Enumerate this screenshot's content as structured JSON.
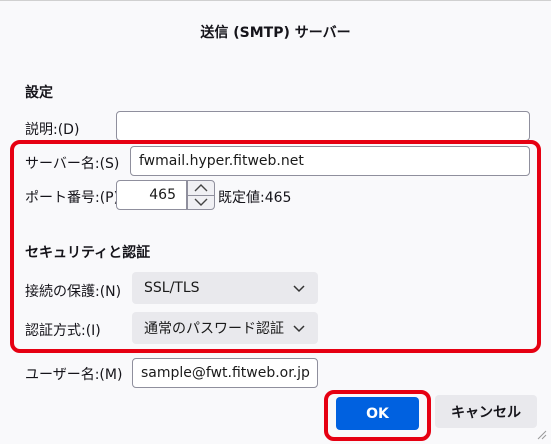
{
  "dialog": {
    "title": "送信 (SMTP) サーバー"
  },
  "settings": {
    "heading": "設定",
    "description_label": "説明:(D)",
    "description_value": "",
    "server_label": "サーバー名:(S)",
    "server_value": "fwmail.hyper.fitweb.net",
    "port_label": "ポート番号:(P)",
    "port_value": "465",
    "port_default": "既定値:465"
  },
  "security": {
    "heading": "セキュリティと認証",
    "connection_label": "接続の保護:(N)",
    "connection_value": "SSL/TLS",
    "auth_label": "認証方式:(I)",
    "auth_value": "通常のパスワード認証",
    "username_label": "ユーザー名:(M)",
    "username_value": "sample@fwt.fitweb.or.jp"
  },
  "buttons": {
    "ok": "OK",
    "cancel": "キャンセル"
  },
  "colors": {
    "highlight": "#e60012",
    "primary": "#0061e0"
  },
  "icons": [
    "chevron-down-icon",
    "chevron-up-icon",
    "resize-grip-icon"
  ]
}
